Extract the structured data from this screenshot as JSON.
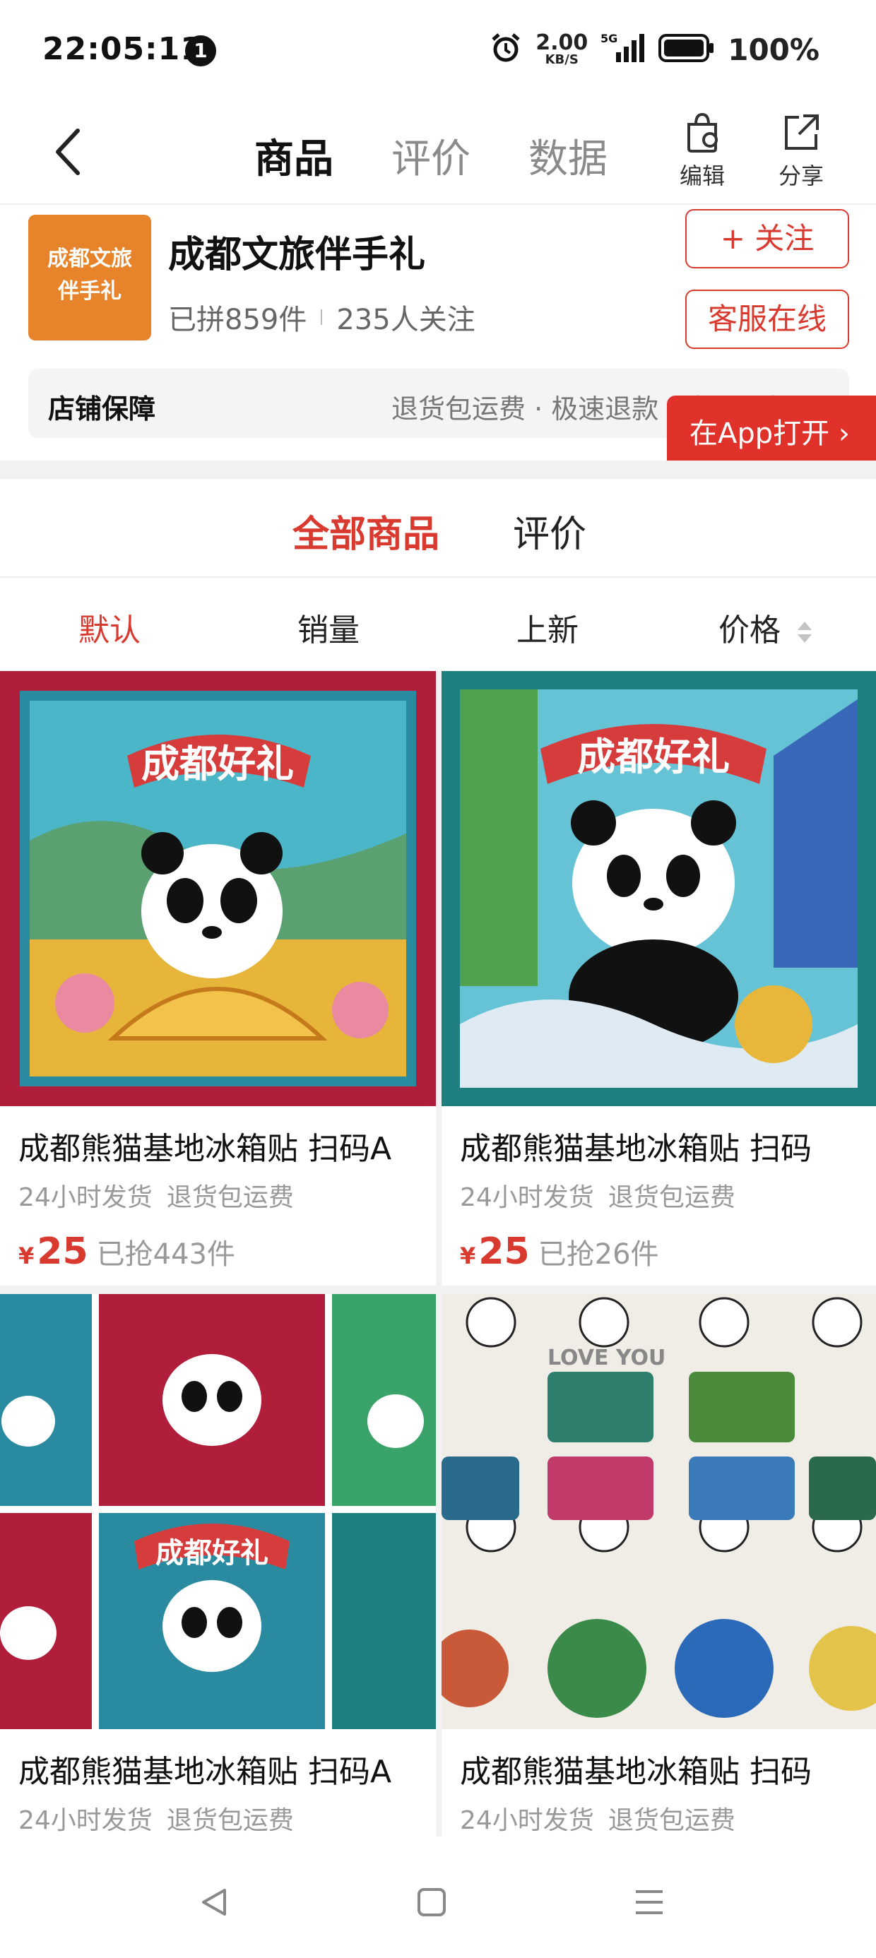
{
  "status_bar": {
    "time": "22:05:11",
    "notification_count": "1",
    "net_speed_value": "2.00",
    "net_speed_unit": "KB/S",
    "network": "5G",
    "battery": "100%"
  },
  "nav": {
    "tabs": [
      {
        "label": "商品",
        "active": true
      },
      {
        "label": "评价",
        "active": false
      },
      {
        "label": "数据",
        "active": false
      }
    ],
    "edit_label": "编辑",
    "share_label": "分享"
  },
  "shop": {
    "logo_text_line1": "成都文旅",
    "logo_text_line2": "伴手礼",
    "name": "成都文旅伴手礼",
    "sold": "已拼859件",
    "followers": "235人关注",
    "follow_button": "+ 关注",
    "service_button": "客服在线",
    "guarantee_label": "店铺保障",
    "guarantee_text": "退货包运费 · 极速退款 · 全场包邮",
    "open_app_button": "在App打开 ›"
  },
  "content_tabs": [
    {
      "label": "全部商品",
      "active": true
    },
    {
      "label": "评价",
      "active": false
    }
  ],
  "sort": [
    {
      "label": "默认",
      "active": true
    },
    {
      "label": "销量",
      "active": false
    },
    {
      "label": "上新",
      "active": false
    },
    {
      "label": "价格",
      "active": false
    }
  ],
  "products": [
    {
      "title": "成都熊猫基地冰箱贴 扫码A",
      "tags": [
        "24小时发货",
        "退货包运费"
      ],
      "price_symbol": "¥",
      "price": "25",
      "sold": "已抢443件",
      "image_text": "成都好礼",
      "image_style": "poster-red"
    },
    {
      "title": "成都熊猫基地冰箱贴 扫码",
      "tags": [
        "24小时发货",
        "退货包运费"
      ],
      "price_symbol": "¥",
      "price": "25",
      "sold": "已抢26件",
      "image_text": "成都好礼",
      "image_style": "poster-teal"
    },
    {
      "title": "成都熊猫基地冰箱贴 扫码A",
      "tags": [
        "24小时发货",
        "退货包运费"
      ],
      "image_text": "成都好礼",
      "image_style": "collage"
    },
    {
      "title": "成都熊猫基地冰箱贴 扫码",
      "tags": [
        "24小时发货",
        "退货包运费"
      ],
      "image_text": "LOVE YOU",
      "image_style": "magnets"
    }
  ],
  "colors": {
    "accent": "#d93a2f",
    "logo_bg": "#e7832b",
    "muted": "#999999"
  }
}
